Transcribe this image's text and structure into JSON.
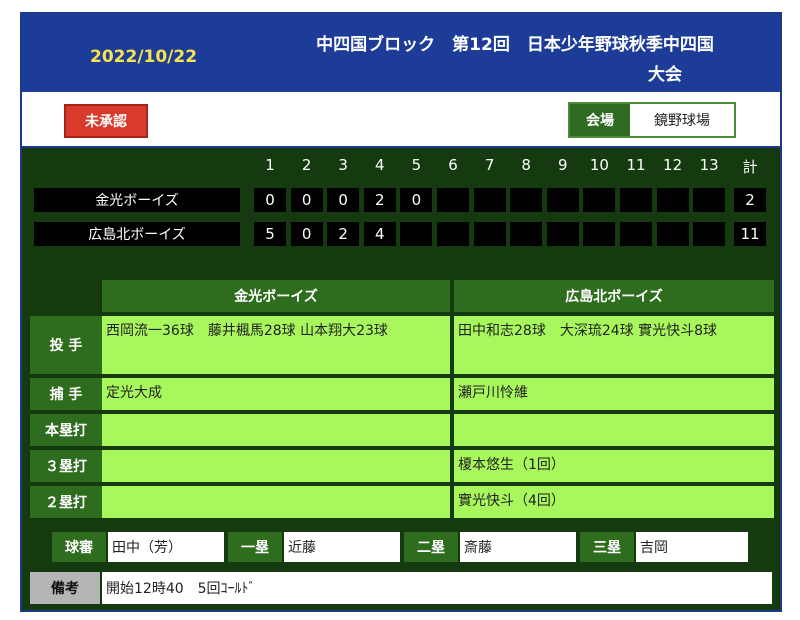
{
  "header": {
    "date": "2022/10/22",
    "title_line1": "中四国ブロック　第12回　日本少年野球秋季中四国",
    "title_line2": "大会"
  },
  "status_button": {
    "label": "未承認"
  },
  "venue": {
    "label": "会場",
    "value": "鏡野球場"
  },
  "scoreboard": {
    "innings": [
      "1",
      "2",
      "3",
      "4",
      "5",
      "6",
      "7",
      "8",
      "9",
      "10",
      "11",
      "12",
      "13"
    ],
    "total_label": "計",
    "teams": [
      {
        "name": "金光ボーイズ",
        "scores": [
          "0",
          "0",
          "0",
          "2",
          "0",
          "",
          "",
          "",
          "",
          "",
          "",
          "",
          ""
        ],
        "total": "2"
      },
      {
        "name": "広島北ボーイズ",
        "scores": [
          "5",
          "0",
          "2",
          "4",
          "",
          "",
          "",
          "",
          "",
          "",
          "",
          "",
          ""
        ],
        "total": "11"
      }
    ]
  },
  "details": {
    "team_headers": [
      "金光ボーイズ",
      "広島北ボーイズ"
    ],
    "rows": [
      {
        "label": "投 手",
        "values": [
          "西岡流一36球　藤井楓馬28球 山本翔大23球",
          "田中和志28球　大深琉24球 實光快斗8球"
        ]
      },
      {
        "label": "捕 手",
        "values": [
          "定光大成",
          "瀬戸川怜維"
        ]
      },
      {
        "label": "本塁打",
        "values": [
          "",
          ""
        ]
      },
      {
        "label": "３塁打",
        "values": [
          "",
          "榎本悠生（1回）"
        ]
      },
      {
        "label": "２塁打",
        "values": [
          "",
          "實光快斗（4回）"
        ]
      }
    ]
  },
  "umpires": [
    {
      "label": "球審",
      "value": "田中（芳）"
    },
    {
      "label": "一塁",
      "value": "近藤"
    },
    {
      "label": "二塁",
      "value": "斎藤"
    },
    {
      "label": "三塁",
      "value": "吉岡"
    }
  ],
  "memo": {
    "label": "備考",
    "value": "開始12時40　5回ｺｰﾙﾄﾞ"
  }
}
